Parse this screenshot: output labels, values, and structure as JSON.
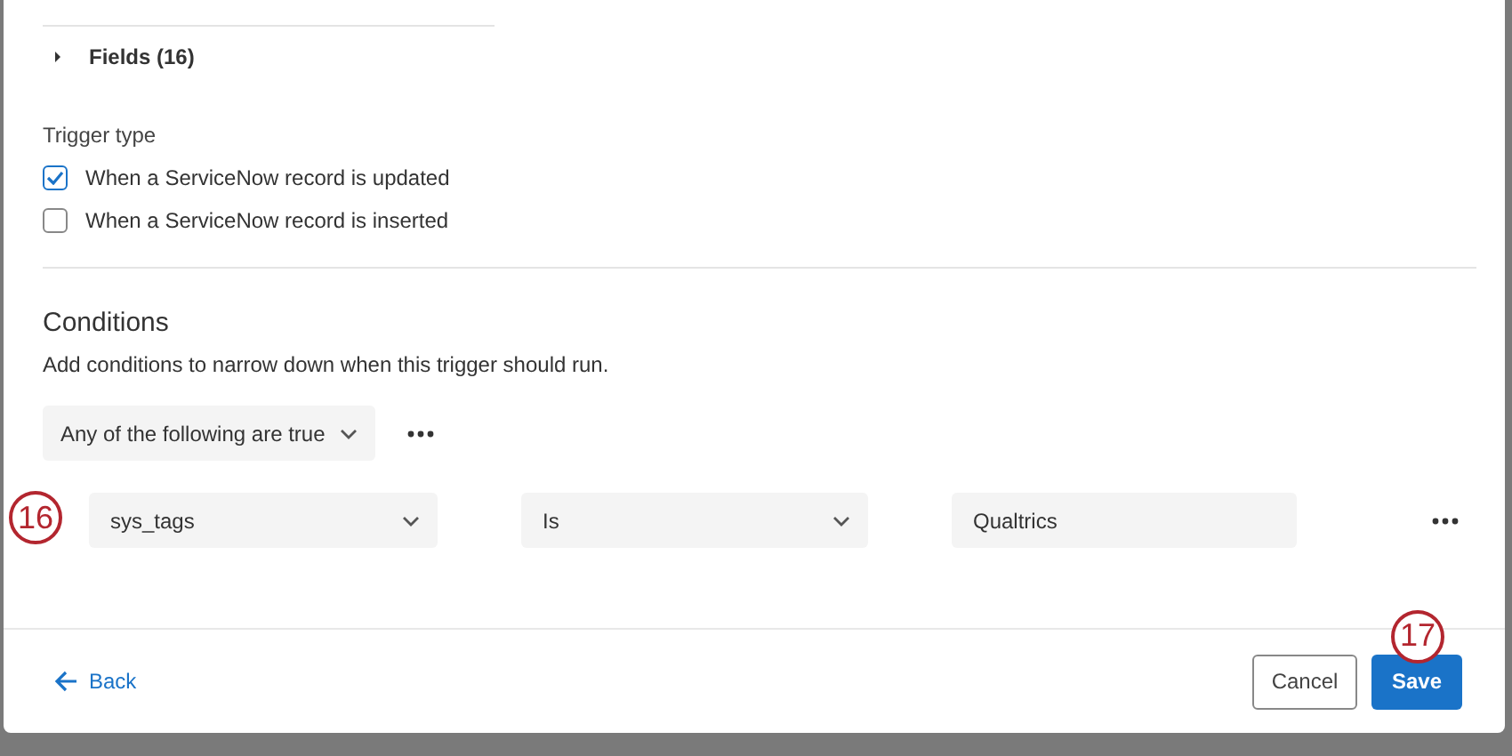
{
  "fields_section": {
    "label": "Fields (16)",
    "expanded": false
  },
  "trigger_type": {
    "label": "Trigger type",
    "options": [
      {
        "label": "When a ServiceNow record is updated",
        "checked": true
      },
      {
        "label": "When a ServiceNow record is inserted",
        "checked": false
      }
    ]
  },
  "conditions": {
    "title": "Conditions",
    "description": "Add conditions to narrow down when this trigger should run.",
    "match": "Any of the following are true",
    "rows": [
      {
        "field": "sys_tags",
        "operator": "Is",
        "value": "Qualtrics",
        "callout": "16"
      }
    ]
  },
  "footer": {
    "back": "Back",
    "cancel": "Cancel",
    "save": "Save",
    "save_callout": "17"
  }
}
